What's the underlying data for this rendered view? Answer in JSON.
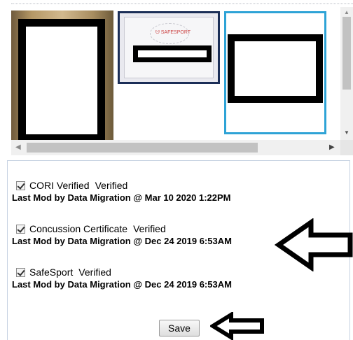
{
  "gallery": {
    "thumbnails": [
      {
        "id": "photo",
        "selected": false
      },
      {
        "id": "certificate",
        "logo_text": "ᗢ SAFESPORT",
        "selected": false
      },
      {
        "id": "document",
        "selected": true
      }
    ]
  },
  "verifications": [
    {
      "name": "CORI Verified",
      "status": "Verified",
      "checked": true,
      "meta": "Last Mod by Data Migration @ Mar 10 2020 1:22PM"
    },
    {
      "name": "Concussion Certificate",
      "status": "Verified",
      "checked": true,
      "meta": "Last Mod by Data Migration @ Dec 24 2019 6:53AM"
    },
    {
      "name": "SafeSport",
      "status": "Verified",
      "checked": true,
      "meta": "Last Mod by Data Migration @ Dec 24 2019 6:53AM"
    }
  ],
  "actions": {
    "save_label": "Save"
  },
  "colors": {
    "selected_border": "#2ea3d6",
    "panel_border": "#c6d2e2"
  }
}
